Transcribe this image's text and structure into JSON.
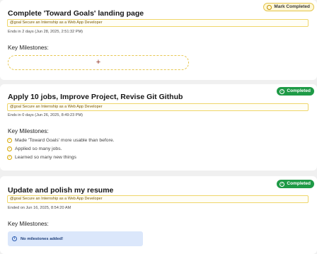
{
  "goals": [
    {
      "title": "Complete 'Toward Goals' landing page",
      "action_label": "Mark Completed",
      "goal_tag": "@goal Secure an Internship as a Web App Developer",
      "meta": "Ends in 2 days (Jun 28, 2025, 2:51:32 PM)",
      "milestones_label": "Key Milestones:",
      "add_symbol": "+"
    },
    {
      "title": "Apply 10 jobs, Improve Project, Revise Git Github",
      "status_label": "Completed",
      "goal_tag": "@goal Secure an Internship as a Web App Developer",
      "meta": "Ends in 0 days (Jun 26, 2025, 8:49:23 PM)",
      "milestones_label": "Key Milestones:",
      "milestones": [
        "Made 'Toward Goals' more usable than before.",
        "Applied so many jobs.",
        "Learned so many new things"
      ]
    },
    {
      "title": "Update and polish my resume",
      "status_label": "Completed",
      "goal_tag": "@goal Secure an Internship as a Web App Developer",
      "meta": "Ended on Jun 16, 2025, 8:54:20 AM",
      "milestones_label": "Key Milestones:",
      "empty_message": "No milestones added!"
    }
  ],
  "colors": {
    "completed_green": "#1e9a46",
    "accent_yellow": "#e4c44a",
    "info_blue_bg": "#dbe7fb"
  },
  "icons": {
    "mark": "circle-icon",
    "completed": "check-circle-icon",
    "milestone": "check-circle-icon",
    "add": "plus-icon",
    "info": "info-icon"
  }
}
